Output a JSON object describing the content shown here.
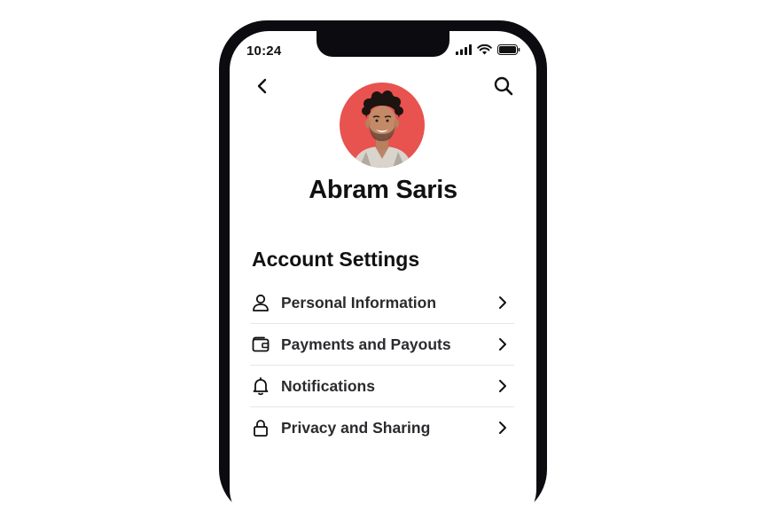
{
  "status_bar": {
    "time": "10:24"
  },
  "profile": {
    "name": "Abram Saris"
  },
  "account_settings": {
    "title": "Account Settings",
    "items": [
      {
        "label": "Personal Information",
        "icon": "user-icon"
      },
      {
        "label": "Payments and Payouts",
        "icon": "wallet-icon"
      },
      {
        "label": "Notifications",
        "icon": "bell-icon"
      },
      {
        "label": "Privacy and Sharing",
        "icon": "lock-icon"
      }
    ]
  },
  "colors": {
    "avatar_bg": "#e8524f",
    "frame": "#0b0b10",
    "text": "#111111"
  }
}
